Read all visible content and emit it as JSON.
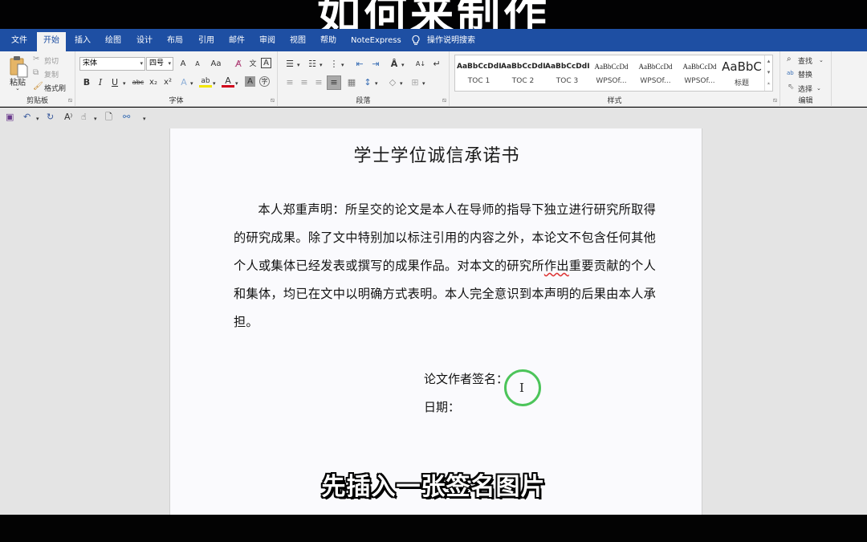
{
  "video_caption_top": "如何来制作",
  "video_caption_bottom": "先插入一张签名图片",
  "tabs": [
    {
      "label": "文件",
      "active": false
    },
    {
      "label": "开始",
      "active": true
    },
    {
      "label": "插入",
      "active": false
    },
    {
      "label": "绘图",
      "active": false
    },
    {
      "label": "设计",
      "active": false
    },
    {
      "label": "布局",
      "active": false
    },
    {
      "label": "引用",
      "active": false
    },
    {
      "label": "邮件",
      "active": false
    },
    {
      "label": "审阅",
      "active": false
    },
    {
      "label": "视图",
      "active": false
    },
    {
      "label": "帮助",
      "active": false
    },
    {
      "label": "NoteExpress",
      "active": false
    }
  ],
  "tell_me": {
    "icon": "lightbulb-icon",
    "label": "操作说明搜索"
  },
  "ribbon": {
    "clipboard": {
      "label": "剪贴板",
      "paste": "粘贴",
      "cut": "剪切",
      "copy": "复制",
      "format_painter": "格式刷"
    },
    "font": {
      "label": "字体",
      "font_name": "宋体",
      "font_size": "四号",
      "grow": "A",
      "shrink": "A",
      "change_case": "Aa",
      "bold": "B",
      "italic": "I",
      "underline": "U",
      "strikethrough": "abc",
      "subscript": "x₂",
      "superscript": "x²",
      "colors": {
        "highlight": "#f2e600",
        "font_color": "#d0021b"
      }
    },
    "paragraph": {
      "label": "段落"
    },
    "styles": {
      "label": "样式",
      "items": [
        {
          "sample": "AaBbCcDdI",
          "name": "TOC 1"
        },
        {
          "sample": "AaBbCcDdI",
          "name": "TOC 2"
        },
        {
          "sample": "AaBbCcDdI",
          "name": "TOC 3"
        },
        {
          "sample": "AaBbCcDd",
          "name": "WPSOf..."
        },
        {
          "sample": "AaBbCcDd",
          "name": "WPSOf..."
        },
        {
          "sample": "AaBbCcDd",
          "name": "WPSOf..."
        },
        {
          "sample": "AaBbC",
          "name": "标题"
        }
      ]
    },
    "editing": {
      "label": "编辑",
      "find": "查找",
      "replace": "替换",
      "select": "选择"
    }
  },
  "document": {
    "title": "学士学位诚信承诺书",
    "body_before": "本人郑重声明：所呈交的论文是本人在导师的指导下独立进行研究所取得的研究成果。除了文中特别加以标注引用的内容之外，本论文不包含任何其他个人或集体已经发表或撰写的成果作品。对本文的研究所",
    "body_flagged": "作出",
    "body_after": "重要贡献的个人和集体，均已在文中以明确方式表明。本人完全意识到本声明的后果由本人承担。",
    "signature_label": "论文作者签名：",
    "date_label": "日期："
  }
}
